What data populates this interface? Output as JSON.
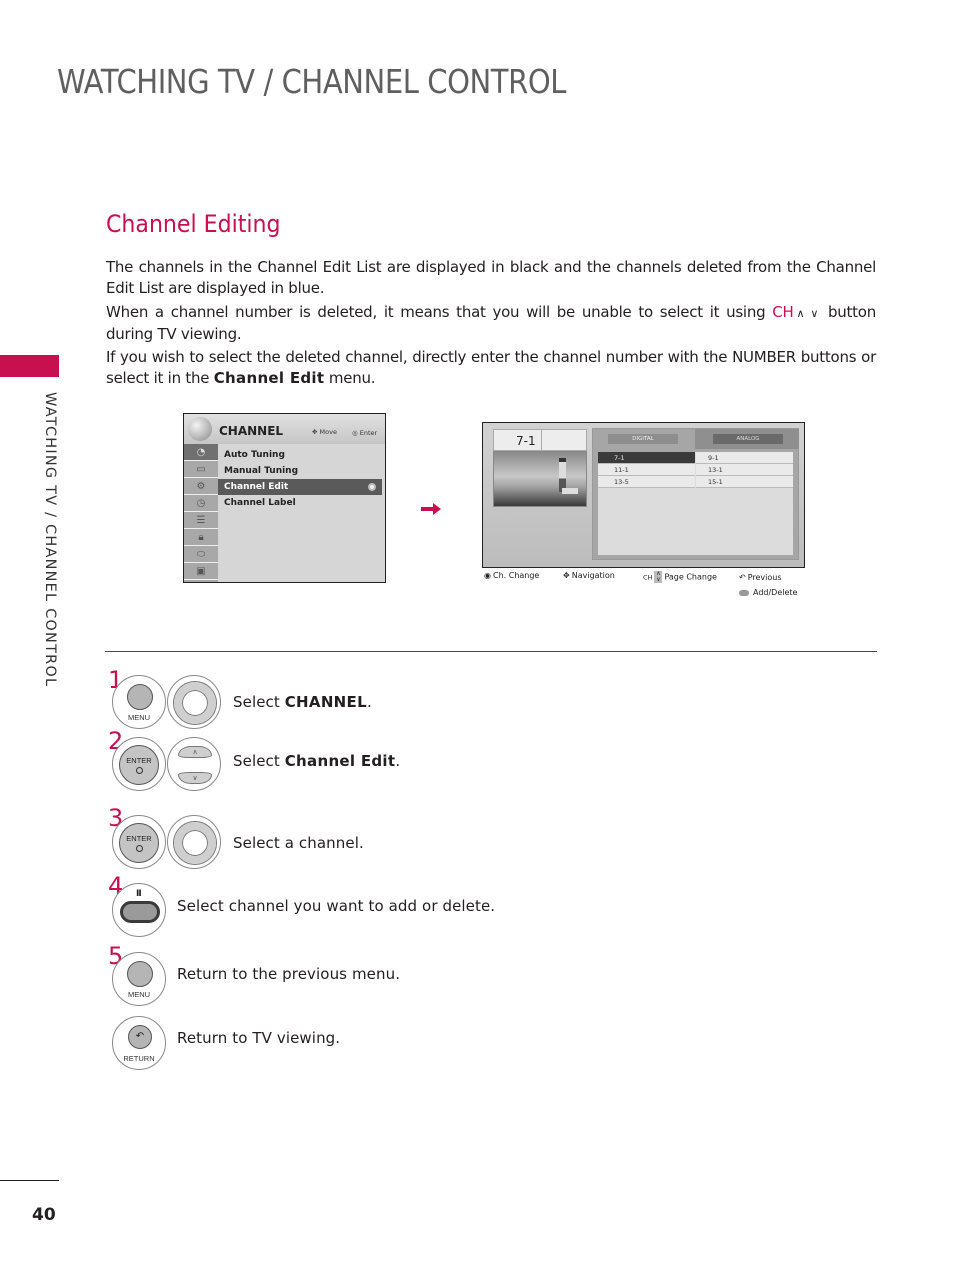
{
  "header": {
    "title": "WATCHING TV / CHANNEL CONTROL"
  },
  "side_tab": {
    "label": "WATCHING TV / CHANNEL CONTROL",
    "accent_color": "#c8104f"
  },
  "section": {
    "title": "Channel Editing"
  },
  "paragraphs": {
    "p1": "The channels in the Channel Edit List are displayed in black and the channels deleted from the Channel Edit List are displayed in blue.",
    "p2_before": "When a channel number is deleted, it means that you will be unable to select it using",
    "p2_ch": "CH",
    "p2_up": "∧",
    "p2_down": "∨",
    "p2_after": "button during TV viewing.",
    "p3_before": "If you wish to select the deleted channel, directly enter the channel number with the NUMBER buttons or select it in the",
    "p3_bold": "Channel Edit",
    "p3_after": "menu."
  },
  "channel_menu": {
    "title": "CHANNEL",
    "move_hint": "Move",
    "enter_hint": "Enter",
    "items": [
      {
        "label": "Auto Tuning",
        "selected": false
      },
      {
        "label": "Manual Tuning",
        "selected": false
      },
      {
        "label": "Channel Edit",
        "selected": true
      },
      {
        "label": "Channel Label",
        "selected": false
      }
    ],
    "side_icons": [
      "channel-icon",
      "picture-icon",
      "audio-icon",
      "time-icon",
      "option-icon",
      "lock-icon",
      "input-icon",
      "usb-icon"
    ]
  },
  "edit_screen": {
    "current_channel": "7-1",
    "tabs": {
      "digital": "DIGITAL",
      "analog": "ANALOG"
    },
    "channels_col1": [
      "7-1",
      "11-1",
      "13-5"
    ],
    "channels_col2": [
      "9-1",
      "13-1",
      "15-1"
    ],
    "selected_channel": "7-1",
    "legend": {
      "ch_change": "Ch. Change",
      "navigation": "Navigation",
      "ch_label": "CH",
      "page_change": "Page Change",
      "previous": "Previous",
      "add_delete": "Add/Delete"
    }
  },
  "steps": [
    {
      "num": "1",
      "text_before": "Select",
      "text_bold": "CHANNEL",
      "text_after": ".",
      "buttons": [
        "MENU",
        "navigation-ring"
      ]
    },
    {
      "num": "2",
      "text_before": "Select",
      "text_bold": "Channel Edit",
      "text_after": ".",
      "buttons": [
        "ENTER",
        "up-down"
      ]
    },
    {
      "num": "3",
      "text_before": "Select a channel.",
      "text_bold": "",
      "text_after": "",
      "buttons": [
        "ENTER",
        "navigation-ring"
      ]
    },
    {
      "num": "4",
      "text_before": "Select channel you want to add or delete.",
      "text_bold": "",
      "text_after": "",
      "buttons": [
        "pause-button"
      ]
    },
    {
      "num": "5",
      "text_before": "Return to the previous menu.",
      "text_bold": "",
      "text_after": "",
      "buttons": [
        "MENU"
      ]
    },
    {
      "num": "",
      "text_before": "Return to TV viewing.",
      "text_bold": "",
      "text_after": "",
      "buttons": [
        "RETURN"
      ]
    }
  ],
  "button_labels": {
    "menu": "MENU",
    "enter": "ENTER",
    "return": "RETURN"
  },
  "footer": {
    "page_number": "40"
  }
}
